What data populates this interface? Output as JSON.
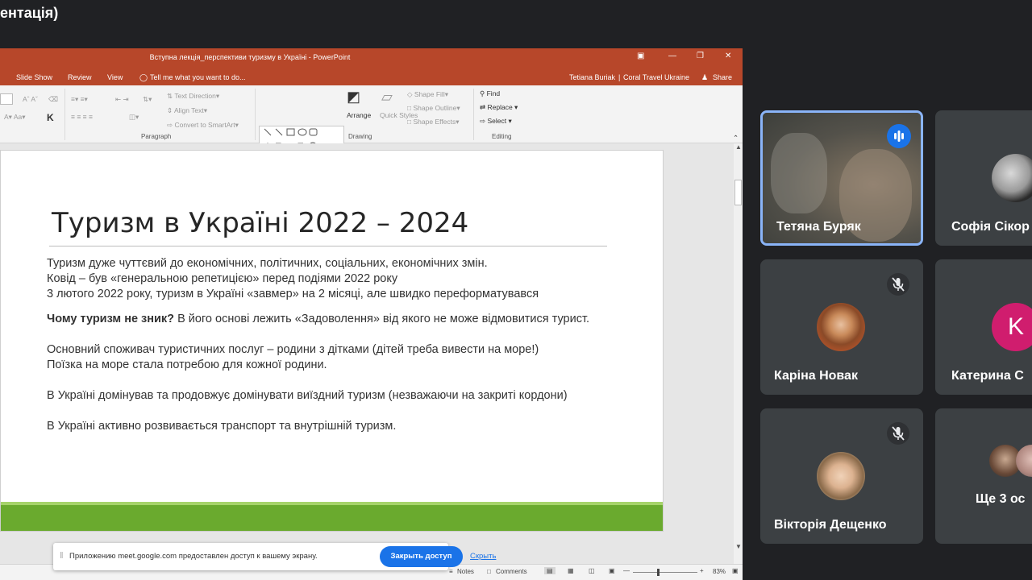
{
  "meet": {
    "title_fragment": "ентація)"
  },
  "ppt": {
    "window_title": "Вступна лекція_перспективи туризму в Україні - PowerPoint",
    "menu": {
      "items": [
        "Slide Show",
        "Review",
        "View"
      ],
      "tell_me": "Tell me what you want to do...",
      "user": "Tetiana Buriak",
      "org": "Coral Travel Ukraine",
      "share": "Share"
    },
    "ribbon": {
      "text_direction": "Text Direction",
      "align_text": "Align Text",
      "convert_smartart": "Convert to SmartArt",
      "paragraph": "Paragraph",
      "arrange": "Arrange",
      "quick_styles": "Quick Styles",
      "shape_fill": "Shape Fill",
      "shape_outline": "Shape Outline",
      "shape_effects": "Shape Effects",
      "drawing": "Drawing",
      "find": "Find",
      "replace": "Replace",
      "select": "Select",
      "editing": "Editing"
    },
    "slide": {
      "title": "Туризм в Україні 2022 – 2024",
      "line1": "Туризм дуже чуттєвий до економічних, політичних, соціальних, економічних змін.",
      "line2": "Ковід – був «генеральною репетицією» перед подіями 2022 року",
      "line3": "3 лютого 2022 року, туризм в Україні «завмер» на 2 місяці, але швидко переформатувався",
      "bold_question": "Чому туризм не зник?",
      "para2_rest": " В  його основі лежить «Задоволення» від якого не може відмовитися турист.",
      "line5": "Основний споживач туристичних послуг – родини з дітками (дітей треба вивести на море!)",
      "line6": "Поїзка на море стала потребою для кожної родини.",
      "line7": "В Україні домінував та продовжує домінувати виїздний туризм (незважаючи на закриті кордони)",
      "line8": "В Україні активно розвивається транспорт та внутрішній туризм."
    },
    "status": {
      "notes": "Notes",
      "comments": "Comments",
      "zoom": "83%"
    }
  },
  "notice": {
    "text": "Приложению meet.google.com предоставлен доступ к вашему экрану.",
    "stop_button": "Закрыть доступ",
    "hide_link": "Скрыть"
  },
  "participants": [
    {
      "name": "Тетяна Буряк",
      "state": "speaking"
    },
    {
      "name": "Софія Сікор"
    },
    {
      "name": "Каріна Новак",
      "state": "muted"
    },
    {
      "name": "Катерина С",
      "initial": "K"
    },
    {
      "name": "Вікторія Дещенко",
      "state": "muted"
    },
    {
      "name": "Ще 3 ос"
    }
  ],
  "colors": {
    "ppt_accent": "#b7472a",
    "meet_bg": "#202124",
    "tile_bg": "#3c4043",
    "speaking_border": "#8ab4f8",
    "button_blue": "#1a73e8",
    "slide_green": "#6aaa2e",
    "avatar_pink": "#d01d6e"
  },
  "icons": [
    "minimize-icon",
    "maximize-icon",
    "close-icon",
    "lightbulb-icon",
    "person-icon",
    "find-icon",
    "mic-off-icon",
    "audio-wave-icon"
  ]
}
